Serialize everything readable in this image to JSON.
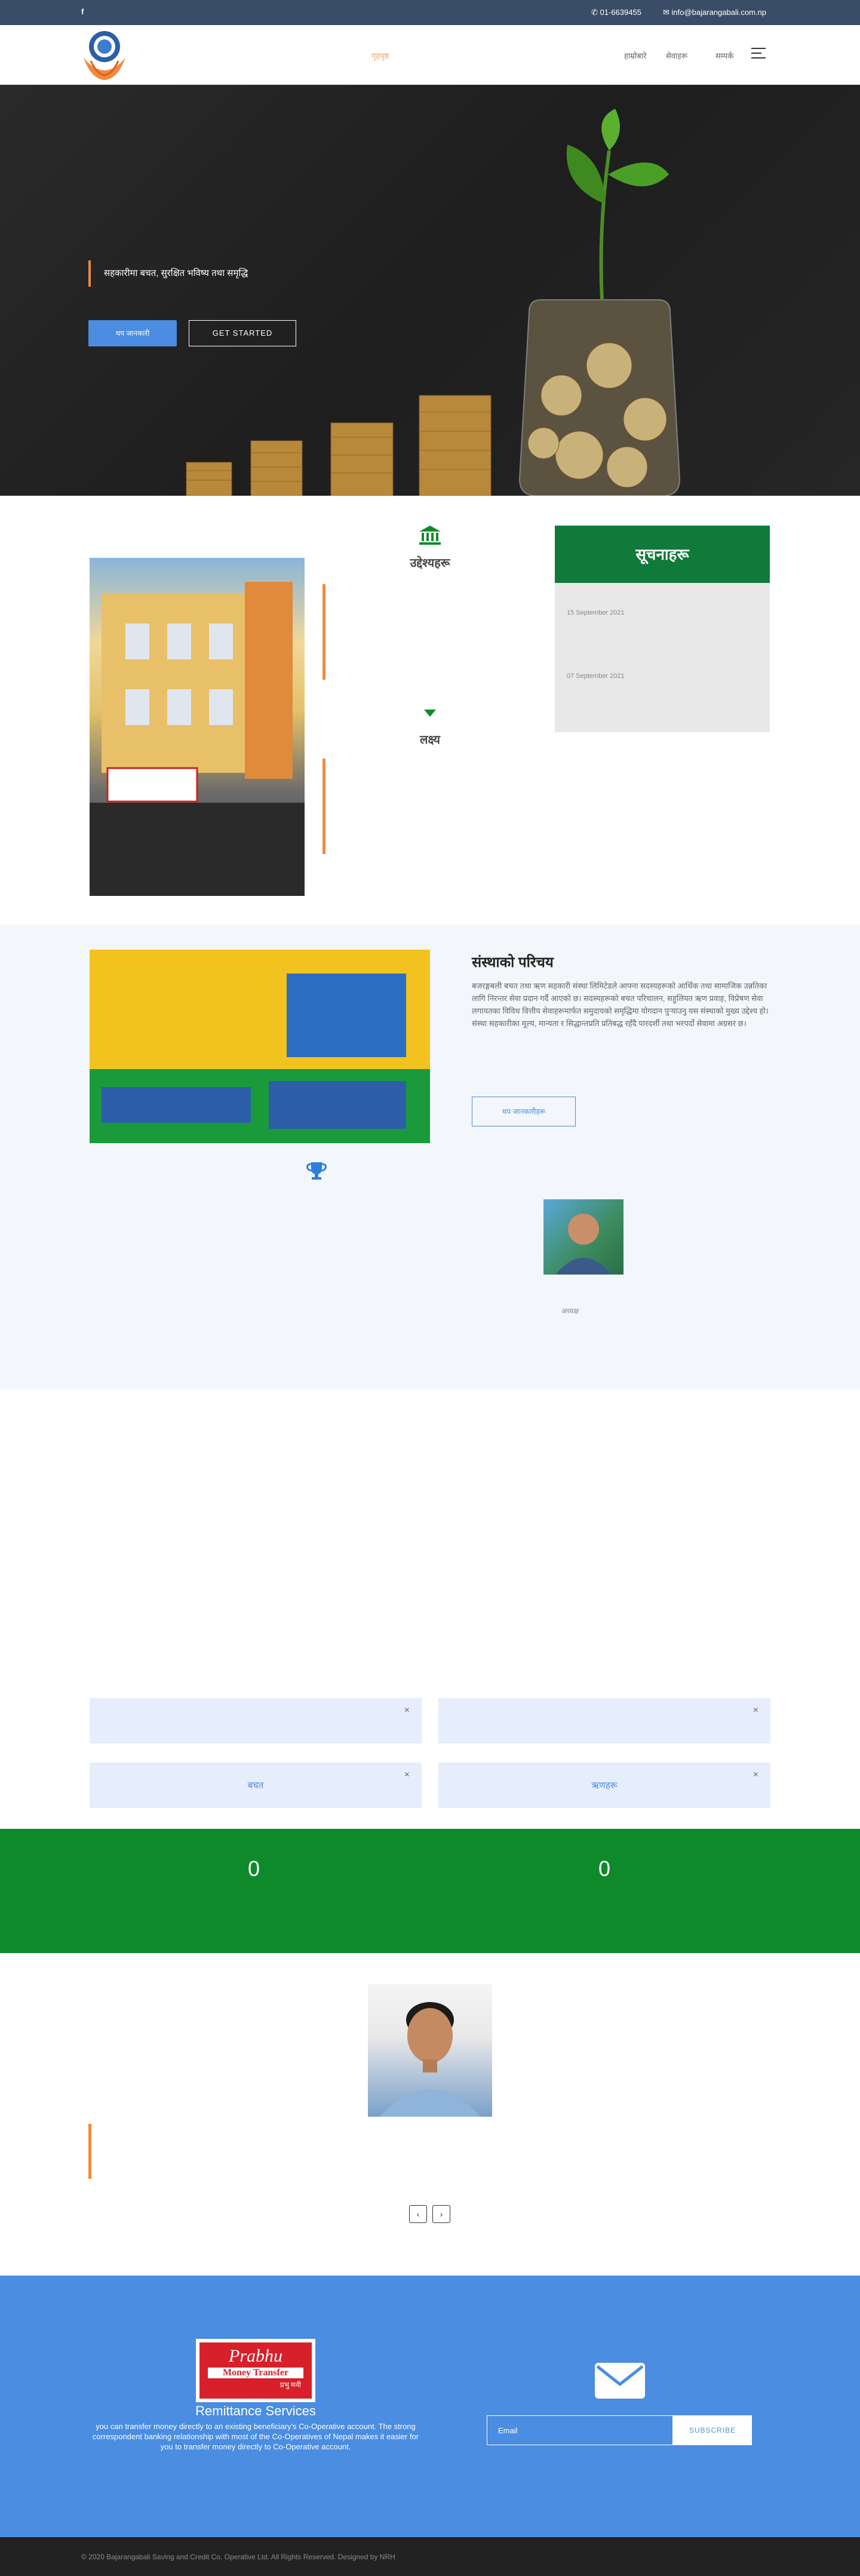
{
  "topbar": {
    "facebook": "f",
    "phone": "01-6639455",
    "email": "info@bajarangabali.com.np"
  },
  "nav": {
    "home": "गृहपृष्ठ",
    "items": [
      "हाम्रोबारे",
      "सेवाहरू",
      "सम्पर्क"
    ]
  },
  "hero": {
    "slogan": "सहकारीमा बचत, सुरक्षित भविष्य तथा समृद्धि",
    "primary_button": "थप जानकारी",
    "secondary_button": "GET STARTED"
  },
  "mission": {
    "title": "उद्देश्यहरू",
    "vision_title": "लक्ष्य"
  },
  "notice": {
    "title": "सूचनाहरू",
    "dates": [
      "15 September 2021",
      "07 September 2021"
    ]
  },
  "intro": {
    "title": "संस्थाको परिचय",
    "text": "बजरङ्गबली बचत तथा ऋण सहकारी संस्था लिमिटेडले आफ्ना सदस्यहरूको आर्थिक तथा सामाजिक उन्नतिका लागि निरन्तर सेवा प्रदान गर्दै आएको छ। सदस्यहरूको बचत परिचालन, सहुलियत ऋण प्रवाह, विप्रेषण सेवा लगायतका विविध वित्तीय सेवाहरूमार्फत समुदायको समृद्धिमा योगदान पुर्‍याउनु यस संस्थाको मुख्य उद्देश्य हो। संस्था सहकारीका मूल्य, मान्यता र सिद्धान्तप्रति प्रतिबद्ध रहँदै पारदर्शी तथा भरपर्दो सेवामा अग्रसर छ।",
    "button": "थप जानकारीहरू",
    "chair_name": "अध्यक्ष"
  },
  "accordions": [
    {
      "label": ""
    },
    {
      "label": ""
    },
    {
      "label": "बचत"
    },
    {
      "label": "ऋणहरू"
    }
  ],
  "counters": [
    {
      "value": "0"
    },
    {
      "value": "0"
    }
  ],
  "testimonial": {
    "prev": "‹",
    "next": "›"
  },
  "remittance": {
    "logo_line1": "Prabhu",
    "logo_line2": "Money Transfer",
    "logo_line3": "प्रभु मनी",
    "title": "Remittance Services",
    "text": "you can transfer money directly to an existing beneficiary's Co-Operative account. The strong correspondent banking relationship with most of the Co-Operatives of Nepal makes it easier for you to transfer money directly to Co-Operative account."
  },
  "subscribe": {
    "placeholder": "Email",
    "button": "SUBSCRIBE"
  },
  "footer": {
    "copyright": "© 2020 Bajarangabali Saving and Credit Co. Operative Ltd. All Rights Reserved. Designed by NRH"
  },
  "colors": {
    "topbar": "#3a4d66",
    "accent_orange": "#f08a3c",
    "primary_blue": "#4a8de1",
    "notice_green": "#0f7a3a",
    "counter_green": "#0f8a2a"
  }
}
